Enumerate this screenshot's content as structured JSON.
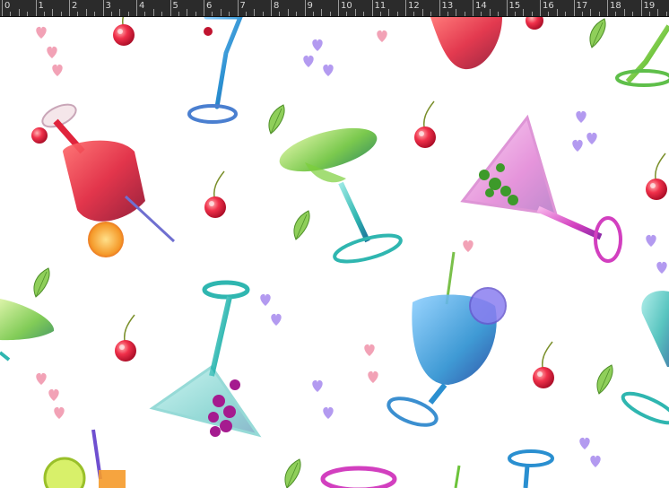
{
  "ruler": {
    "unit": "cm",
    "labels": [
      "0",
      "1",
      "2",
      "3",
      "4",
      "5",
      "6",
      "7",
      "8",
      "9",
      "10",
      "11",
      "12",
      "13",
      "14",
      "15",
      "16",
      "17",
      "18",
      "19"
    ]
  },
  "canvas": {
    "pattern": "watercolor cocktail glasses with cherries, leaves and hearts",
    "colors": {
      "background": "#ffffff",
      "ruler": "#2b2b2b",
      "red": "#e0243c",
      "green": "#7ccf3a",
      "teal": "#2fb6b0",
      "magenta": "#d23fbf",
      "blue": "#2a8fd0",
      "heart_pink": "#f2a2b6",
      "heart_violet": "#b39af0",
      "orange": "#f59a2a"
    }
  }
}
